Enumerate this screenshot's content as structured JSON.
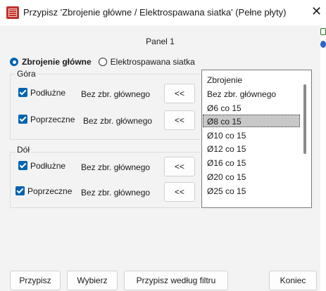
{
  "window": {
    "title": "Przypisz 'Zbrojenie główne / Elektrospawana siatka' (Pełne płyty)",
    "close_glyph": "✕"
  },
  "panel_label": "Panel 1",
  "radio": {
    "option1": "Zbrojenie główne",
    "option2": "Elektrospawana siatka",
    "selected": "Zbrojenie główne"
  },
  "top_group": {
    "title": "Góra",
    "rows": [
      {
        "label": "Podłużne",
        "value": "Bez zbr. głównego",
        "button": "<<",
        "checked": true
      },
      {
        "label": "Poprzeczne",
        "value": "Bez zbr. głównego",
        "button": "<<",
        "checked": true
      }
    ]
  },
  "bottom_group": {
    "title": "Dół",
    "rows": [
      {
        "label": "Podłużne",
        "value": "Bez zbr. głównego",
        "button": "<<",
        "checked": true
      },
      {
        "label": "Poprzeczne",
        "value": "Bez zbr. głównego",
        "button": "<<",
        "checked": true
      }
    ]
  },
  "list": {
    "items": [
      "Zbrojenie",
      "Bez zbr. głównego",
      "Ø6 co 15",
      "Ø8 co 15",
      "Ø10 co 15",
      "Ø12 co 15",
      "Ø16 co 15",
      "Ø20 co 15",
      "Ø25 co 15"
    ],
    "selected": "Ø8 co 15"
  },
  "buttons": {
    "przypisz": "Przypisz",
    "wybierz": "Wybierz",
    "przypisz_filtr": "Przypisz według filtru",
    "koniec": "Koniec"
  },
  "icons": {
    "app": "app-icon",
    "side1": "layer-icon",
    "side2": "globe-icon"
  },
  "colors": {
    "accent": "#0063b1",
    "app_icon": "#c0322b",
    "selection": "#c8c8c8"
  }
}
